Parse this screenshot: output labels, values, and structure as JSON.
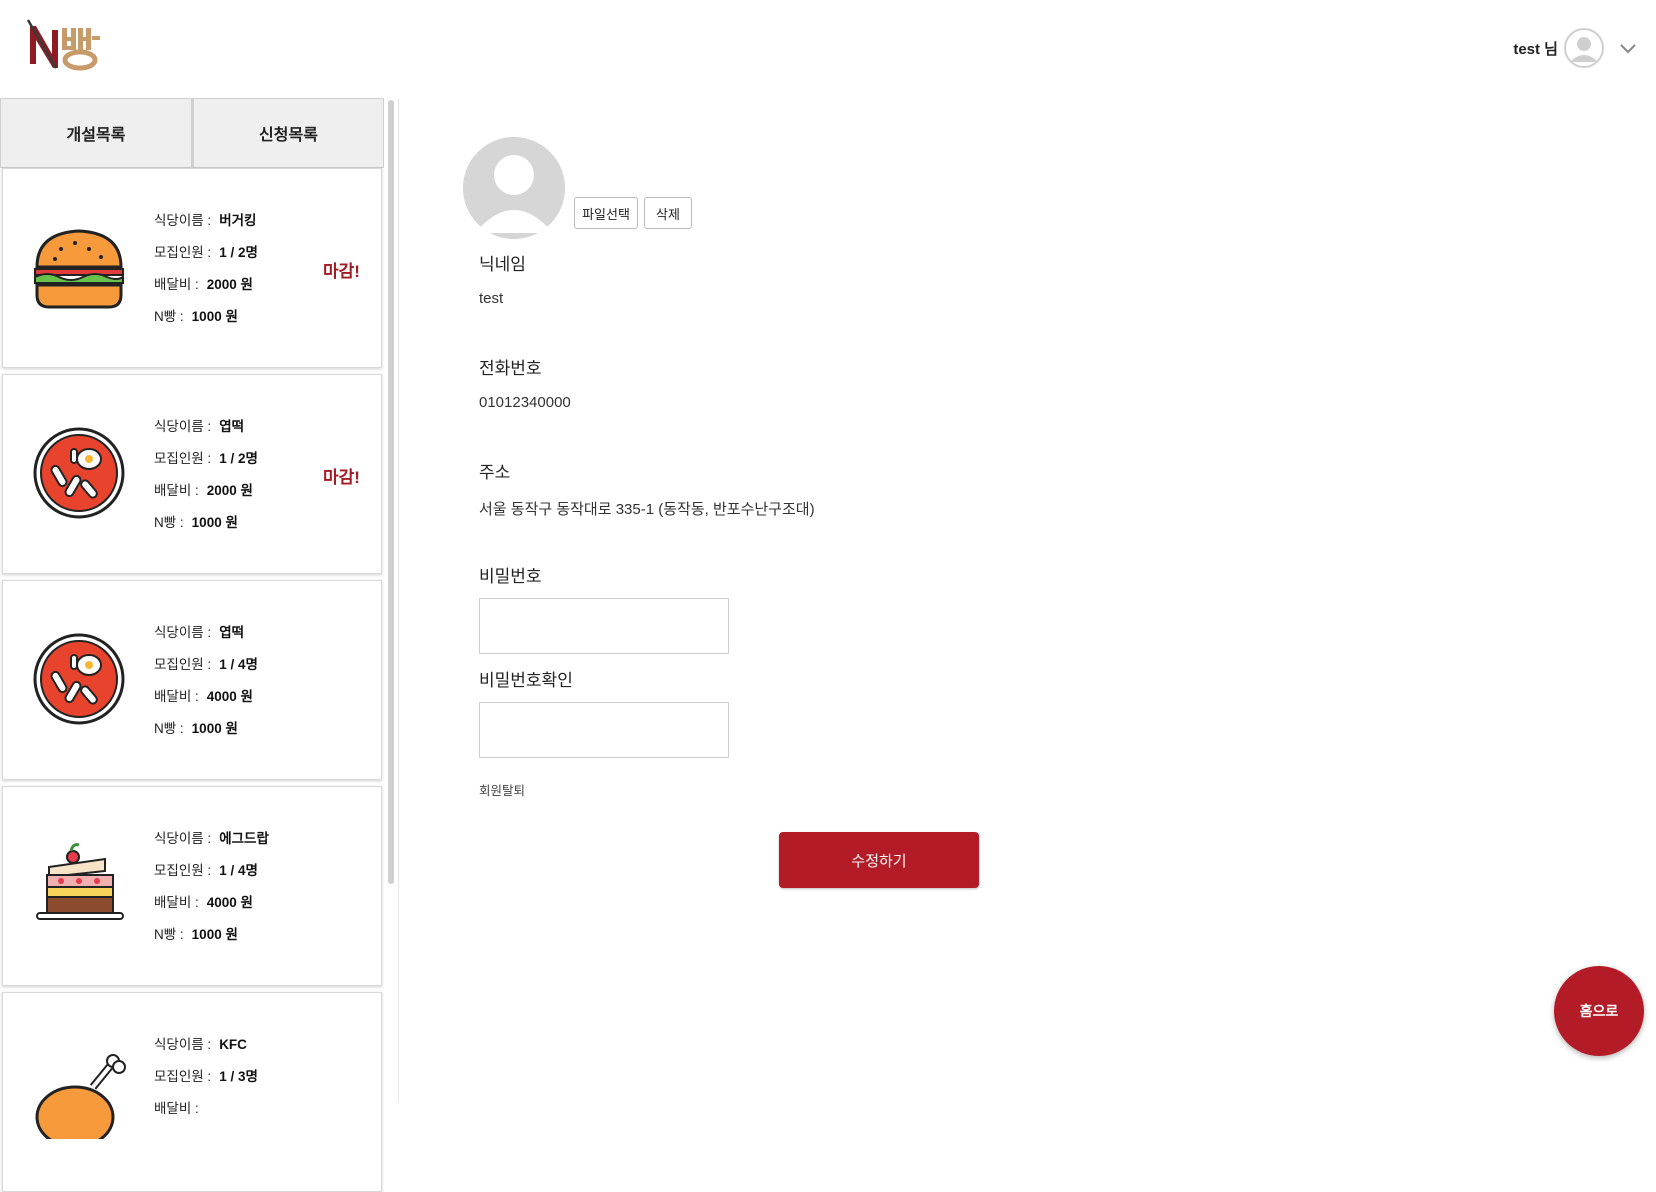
{
  "header": {
    "logo_text": "N빵",
    "user_name": "test 님"
  },
  "sidebar": {
    "tabs": [
      "개설목록",
      "신청목록"
    ],
    "labels": {
      "restaurant": "식당이름 :",
      "recruit": "모집인원 :",
      "delivery_fee": "배달비 :",
      "nbbang": "N빵 :"
    },
    "cards": [
      {
        "icon": "burger-icon",
        "restaurant": "버거킹",
        "recruit": "1 / 2명",
        "delivery_fee": "2000 원",
        "nbbang": "1000 원",
        "status": "마감!"
      },
      {
        "icon": "tteokbokki-icon",
        "restaurant": "엽떡",
        "recruit": "1 / 2명",
        "delivery_fee": "2000 원",
        "nbbang": "1000 원",
        "status": "마감!"
      },
      {
        "icon": "tteokbokki-icon",
        "restaurant": "엽떡",
        "recruit": "1 / 4명",
        "delivery_fee": "4000 원",
        "nbbang": "1000 원",
        "status": ""
      },
      {
        "icon": "cake-icon",
        "restaurant": "에그드랍",
        "recruit": "1 / 4명",
        "delivery_fee": "4000 원",
        "nbbang": "1000 원",
        "status": ""
      },
      {
        "icon": "chicken-icon",
        "restaurant": "KFC",
        "recruit": "1 / 3명",
        "delivery_fee": "",
        "nbbang": "",
        "status": ""
      }
    ]
  },
  "profile": {
    "file_select_label": "파일선택",
    "delete_label": "삭제",
    "nickname_label": "닉네임",
    "nickname_value": "test",
    "phone_label": "전화번호",
    "phone_value": "01012340000",
    "address_label": "주소",
    "address_value": "서울 동작구 동작대로 335-1 (동작동, 반포수난구조대)",
    "password_label": "비밀번호",
    "password_confirm_label": "비밀번호확인",
    "withdraw_label": "회원탈퇴",
    "submit_label": "수정하기"
  },
  "home_button_label": "홈으로",
  "colors": {
    "brand_red": "#b31b26",
    "logo_red": "#8e1a22",
    "logo_tan": "#c79a6a",
    "tab_bg": "#efefef"
  }
}
